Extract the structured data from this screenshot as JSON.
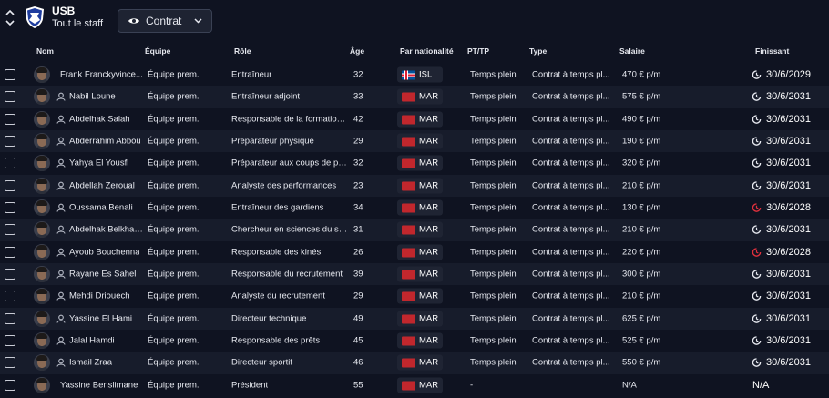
{
  "header": {
    "club_name": "USB",
    "subtitle": "Tout le staff",
    "view_selector": {
      "label": "Contrat"
    }
  },
  "columns": {
    "name": "Nom",
    "team": "Équipe",
    "role": "Rôle",
    "age": "Âge",
    "nationality": "Par nationalité",
    "pt": "PT/TP",
    "type": "Type",
    "salary": "Salaire",
    "expiry": "Finissant"
  },
  "colors": {
    "background": "#0f1321",
    "row_alt": "#171c2b",
    "expiry_warning": "#e0303d",
    "expiry_normal": "#e6e8ef"
  },
  "rows": [
    {
      "name": "Frank Franckyvince...",
      "staff_icon": false,
      "team": "Équipe prem.",
      "role": "Entraîneur",
      "age": "32",
      "nat": "ISL",
      "flag": "isl",
      "pt": "Temps plein",
      "type": "Contrat à temps pl...",
      "salary": "470 € p/m",
      "expiry": "30/6/2029",
      "warn": false
    },
    {
      "name": "Nabil Loune",
      "staff_icon": true,
      "team": "Équipe prem.",
      "role": "Entraîneur adjoint",
      "age": "33",
      "nat": "MAR",
      "flag": "mar",
      "pt": "Temps plein",
      "type": "Contrat à temps pl...",
      "salary": "575 € p/m",
      "expiry": "30/6/2031",
      "warn": false
    },
    {
      "name": "Abdelhak Salah",
      "staff_icon": true,
      "team": "Équipe prem.",
      "role": "Responsable de la formation j...",
      "age": "42",
      "nat": "MAR",
      "flag": "mar",
      "pt": "Temps plein",
      "type": "Contrat à temps pl...",
      "salary": "490 € p/m",
      "expiry": "30/6/2031",
      "warn": false
    },
    {
      "name": "Abderrahim Abbou",
      "staff_icon": true,
      "team": "Équipe prem.",
      "role": "Préparateur physique",
      "age": "29",
      "nat": "MAR",
      "flag": "mar",
      "pt": "Temps plein",
      "type": "Contrat à temps pl...",
      "salary": "190 € p/m",
      "expiry": "30/6/2031",
      "warn": false
    },
    {
      "name": "Yahya El Yousfi",
      "staff_icon": true,
      "team": "Équipe prem.",
      "role": "Préparateur aux coups de pie...",
      "age": "32",
      "nat": "MAR",
      "flag": "mar",
      "pt": "Temps plein",
      "type": "Contrat à temps pl...",
      "salary": "320 € p/m",
      "expiry": "30/6/2031",
      "warn": false
    },
    {
      "name": "Abdellah Zeroual",
      "staff_icon": true,
      "team": "Équipe prem.",
      "role": "Analyste des performances",
      "age": "23",
      "nat": "MAR",
      "flag": "mar",
      "pt": "Temps plein",
      "type": "Contrat à temps pl...",
      "salary": "210 € p/m",
      "expiry": "30/6/2031",
      "warn": false
    },
    {
      "name": "Oussama Benali",
      "staff_icon": true,
      "team": "Équipe prem.",
      "role": "Entraîneur des gardiens",
      "age": "34",
      "nat": "MAR",
      "flag": "mar",
      "pt": "Temps plein",
      "type": "Contrat à temps pl...",
      "salary": "130 € p/m",
      "expiry": "30/6/2028",
      "warn": true
    },
    {
      "name": "Abdelhak Belkhay...",
      "staff_icon": true,
      "team": "Équipe prem.",
      "role": "Chercheur en sciences du sport",
      "age": "31",
      "nat": "MAR",
      "flag": "mar",
      "pt": "Temps plein",
      "type": "Contrat à temps pl...",
      "salary": "210 € p/m",
      "expiry": "30/6/2031",
      "warn": false
    },
    {
      "name": "Ayoub Bouchenna",
      "staff_icon": true,
      "team": "Équipe prem.",
      "role": "Responsable des kinés",
      "age": "26",
      "nat": "MAR",
      "flag": "mar",
      "pt": "Temps plein",
      "type": "Contrat à temps pl...",
      "salary": "220 € p/m",
      "expiry": "30/6/2028",
      "warn": true
    },
    {
      "name": "Rayane Es Sahel",
      "staff_icon": true,
      "team": "Équipe prem.",
      "role": "Responsable du recrutement",
      "age": "39",
      "nat": "MAR",
      "flag": "mar",
      "pt": "Temps plein",
      "type": "Contrat à temps pl...",
      "salary": "300 € p/m",
      "expiry": "30/6/2031",
      "warn": false
    },
    {
      "name": "Mehdi Driouech",
      "staff_icon": true,
      "team": "Équipe prem.",
      "role": "Analyste du recrutement",
      "age": "29",
      "nat": "MAR",
      "flag": "mar",
      "pt": "Temps plein",
      "type": "Contrat à temps pl...",
      "salary": "210 € p/m",
      "expiry": "30/6/2031",
      "warn": false
    },
    {
      "name": "Yassine El Hami",
      "staff_icon": true,
      "team": "Équipe prem.",
      "role": "Directeur technique",
      "age": "49",
      "nat": "MAR",
      "flag": "mar",
      "pt": "Temps plein",
      "type": "Contrat à temps pl...",
      "salary": "625 € p/m",
      "expiry": "30/6/2031",
      "warn": false
    },
    {
      "name": "Jalal Hamdi",
      "staff_icon": true,
      "team": "Équipe prem.",
      "role": "Responsable des prêts",
      "age": "45",
      "nat": "MAR",
      "flag": "mar",
      "pt": "Temps plein",
      "type": "Contrat à temps pl...",
      "salary": "525 € p/m",
      "expiry": "30/6/2031",
      "warn": false
    },
    {
      "name": "Ismail Zraa",
      "staff_icon": true,
      "team": "Équipe prem.",
      "role": "Directeur sportif",
      "age": "46",
      "nat": "MAR",
      "flag": "mar",
      "pt": "Temps plein",
      "type": "Contrat à temps pl...",
      "salary": "550 € p/m",
      "expiry": "30/6/2031",
      "warn": false
    },
    {
      "name": "Yassine Benslimane",
      "staff_icon": false,
      "team": "Équipe prem.",
      "role": "Président",
      "age": "55",
      "nat": "MAR",
      "flag": "mar",
      "pt": "-",
      "type": "",
      "salary": "N/A",
      "expiry": "N/A",
      "warn": false,
      "no_clock": true
    }
  ]
}
